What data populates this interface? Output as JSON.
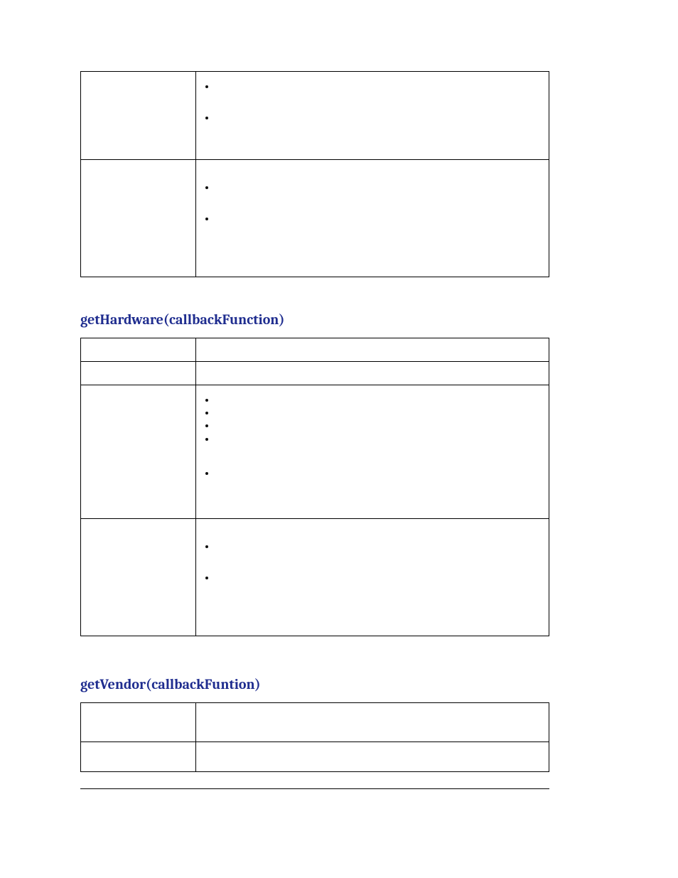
{
  "section1": {
    "rows": [
      {
        "label": "",
        "bullets": [
          "",
          ""
        ]
      },
      {
        "label": "",
        "bullets": [
          "",
          ""
        ]
      }
    ]
  },
  "section2": {
    "heading": "getHardware(callbackFunction)",
    "rows": [
      {
        "label": "",
        "text": ""
      },
      {
        "label": "",
        "text": ""
      },
      {
        "label": "",
        "bullets": [
          "",
          "",
          "",
          "",
          ""
        ]
      },
      {
        "label": "",
        "bullets": [
          "",
          ""
        ]
      }
    ]
  },
  "section3": {
    "heading": "getVendor(callbackFuntion)",
    "rows": [
      {
        "label": "",
        "text": ""
      },
      {
        "label": "",
        "text": ""
      }
    ]
  }
}
